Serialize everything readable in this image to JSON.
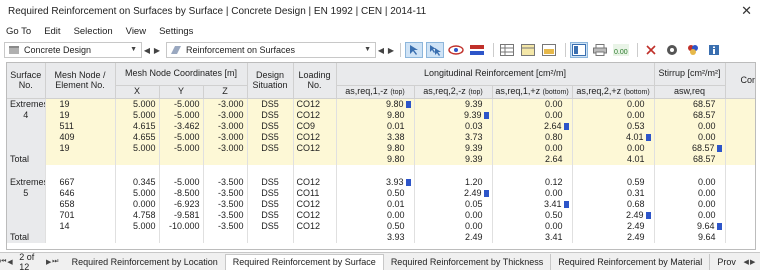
{
  "window": {
    "title": "Required Reinforcement on Surfaces by Surface | Concrete Design | EN 1992 | CEN | 2014-11"
  },
  "menu": {
    "items": [
      "Go To",
      "Edit",
      "Selection",
      "View",
      "Settings"
    ]
  },
  "toolbar": {
    "module_combo": "Concrete Design",
    "result_combo": "Reinforcement on Surfaces"
  },
  "table": {
    "group_headers": {
      "surface_no": "Surface No.",
      "mesh_node": "Mesh Node / Element No.",
      "coords": "Mesh Node Coordinates [m]",
      "design_situation": "Design Situation",
      "loading_no": "Loading No.",
      "longitudinal": "Longitudinal Reinforcement [cm²/m]",
      "stirrup": "Stirrup [cm²/m²]",
      "comment": "Comment"
    },
    "sub_headers": {
      "x": "X",
      "y": "Y",
      "z": "Z",
      "a1_main": "as,req,1,-z",
      "a1_sub": "(top)",
      "a2_main": "as,req,2,-z",
      "a2_sub": "(top)",
      "a3_main": "as,req,1,+z",
      "a3_sub": "(bottom)",
      "a4_main": "as,req,2,+z",
      "a4_sub": "(bottom)",
      "sw": "asw,req"
    },
    "group1": {
      "label_top": "Extremes",
      "label_bottom": "4",
      "total_label": "Total",
      "rows": [
        {
          "node": "19",
          "x": "5.000",
          "y": "-5.000",
          "z": "-3.000",
          "ds": "DS5",
          "lo": "CO12",
          "a1": "9.80",
          "a2": "9.39",
          "a3": "0.00",
          "a4": "0.00",
          "sw": "68.57",
          "comment": ""
        },
        {
          "node": "19",
          "x": "5.000",
          "y": "-5.000",
          "z": "-3.000",
          "ds": "DS5",
          "lo": "CO12",
          "a1": "9.80",
          "a2": "9.39",
          "a3": "0.00",
          "a4": "0.00",
          "sw": "68.57",
          "comment": ""
        },
        {
          "node": "511",
          "x": "4.615",
          "y": "-3.462",
          "z": "-3.000",
          "ds": "DS5",
          "lo": "CO9",
          "a1": "0.01",
          "a2": "0.03",
          "a3": "2.64",
          "a4": "0.53",
          "sw": "0.00",
          "comment": ""
        },
        {
          "node": "409",
          "x": "4.655",
          "y": "-5.000",
          "z": "-3.000",
          "ds": "DS5",
          "lo": "CO12",
          "a1": "3.38",
          "a2": "3.73",
          "a3": "0.80",
          "a4": "4.01",
          "sw": "0.00",
          "comment": ""
        },
        {
          "node": "19",
          "x": "5.000",
          "y": "-5.000",
          "z": "-3.000",
          "ds": "DS5",
          "lo": "CO12",
          "a1": "9.80",
          "a2": "9.39",
          "a3": "0.00",
          "a4": "0.00",
          "sw": "68.57",
          "comment": ""
        }
      ],
      "total": {
        "a1": "9.80",
        "a2": "9.39",
        "a3": "2.64",
        "a4": "4.01",
        "sw": "68.57"
      }
    },
    "group2": {
      "label_top": "Extremes",
      "label_bottom": "5",
      "total_label": "Total",
      "rows": [
        {
          "node": "667",
          "x": "0.345",
          "y": "-5.000",
          "z": "-3.500",
          "ds": "DS5",
          "lo": "CO12",
          "a1": "3.93",
          "a2": "1.20",
          "a3": "0.12",
          "a4": "0.59",
          "sw": "0.00",
          "comment": ""
        },
        {
          "node": "646",
          "x": "5.000",
          "y": "-8.500",
          "z": "-3.500",
          "ds": "DS5",
          "lo": "CO11",
          "a1": "0.50",
          "a2": "2.49",
          "a3": "0.00",
          "a4": "0.31",
          "sw": "0.00",
          "comment": ""
        },
        {
          "node": "658",
          "x": "0.000",
          "y": "-6.923",
          "z": "-3.500",
          "ds": "DS5",
          "lo": "CO12",
          "a1": "0.01",
          "a2": "0.05",
          "a3": "3.41",
          "a4": "0.68",
          "sw": "0.00",
          "comment": ""
        },
        {
          "node": "701",
          "x": "4.758",
          "y": "-9.581",
          "z": "-3.500",
          "ds": "DS5",
          "lo": "CO12",
          "a1": "0.00",
          "a2": "0.00",
          "a3": "0.50",
          "a4": "2.49",
          "sw": "0.00",
          "comment": ""
        },
        {
          "node": "14",
          "x": "5.000",
          "y": "-10.000",
          "z": "-3.500",
          "ds": "DS5",
          "lo": "CO12",
          "a1": "0.50",
          "a2": "0.00",
          "a3": "0.00",
          "a4": "2.49",
          "sw": "9.64",
          "comment": ""
        }
      ],
      "total": {
        "a1": "3.93",
        "a2": "2.49",
        "a3": "3.41",
        "a4": "2.49",
        "sw": "9.64"
      }
    }
  },
  "pager": {
    "text": "2 of 12"
  },
  "tabs": [
    {
      "label": "Required Reinforcement by Location"
    },
    {
      "label": "Required Reinforcement by Surface"
    },
    {
      "label": "Required Reinforcement by Thickness"
    },
    {
      "label": "Required Reinforcement by Material"
    },
    {
      "label": "Prov"
    }
  ],
  "colors": {
    "row_highlight": "#fdf8d6",
    "marker": "#2d55c9",
    "header_bg": "#e9eaec"
  }
}
